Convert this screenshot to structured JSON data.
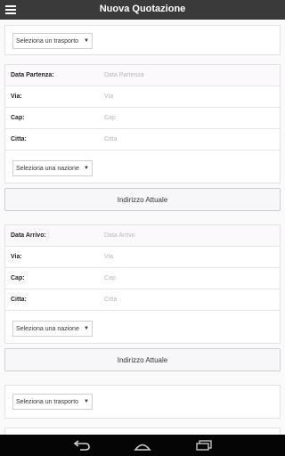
{
  "app": {
    "title": "Nuova Quotazione"
  },
  "transport_select_top": {
    "value": "Seleziona un trasporto"
  },
  "departure": {
    "date_label": "Data Partenza:",
    "date_placeholder": "Data Partenza",
    "street_label": "Via:",
    "street_placeholder": "Via",
    "zip_label": "Cap:",
    "zip_placeholder": "Cap",
    "city_label": "Citta:",
    "city_placeholder": "Citta",
    "country_select": "Seleziona una nazione",
    "current_address_button": "Indirizzo Attuale"
  },
  "arrival": {
    "date_label": "Data Arrivo:",
    "date_placeholder": "Data Arrivo",
    "street_label": "Via:",
    "street_placeholder": "Via",
    "zip_label": "Cap:",
    "zip_placeholder": "Cap",
    "city_label": "Citta:",
    "city_placeholder": "Citta",
    "country_select": "Seleziona una nazione",
    "current_address_button": "Indirizzo Attuale"
  },
  "transport_select_bottom": {
    "value": "Seleziona un trasporto"
  },
  "icons": {
    "menu": "menu-icon",
    "dropdown": "caret-down-icon",
    "back": "back-icon",
    "home": "home-icon",
    "recents": "recents-icon"
  }
}
